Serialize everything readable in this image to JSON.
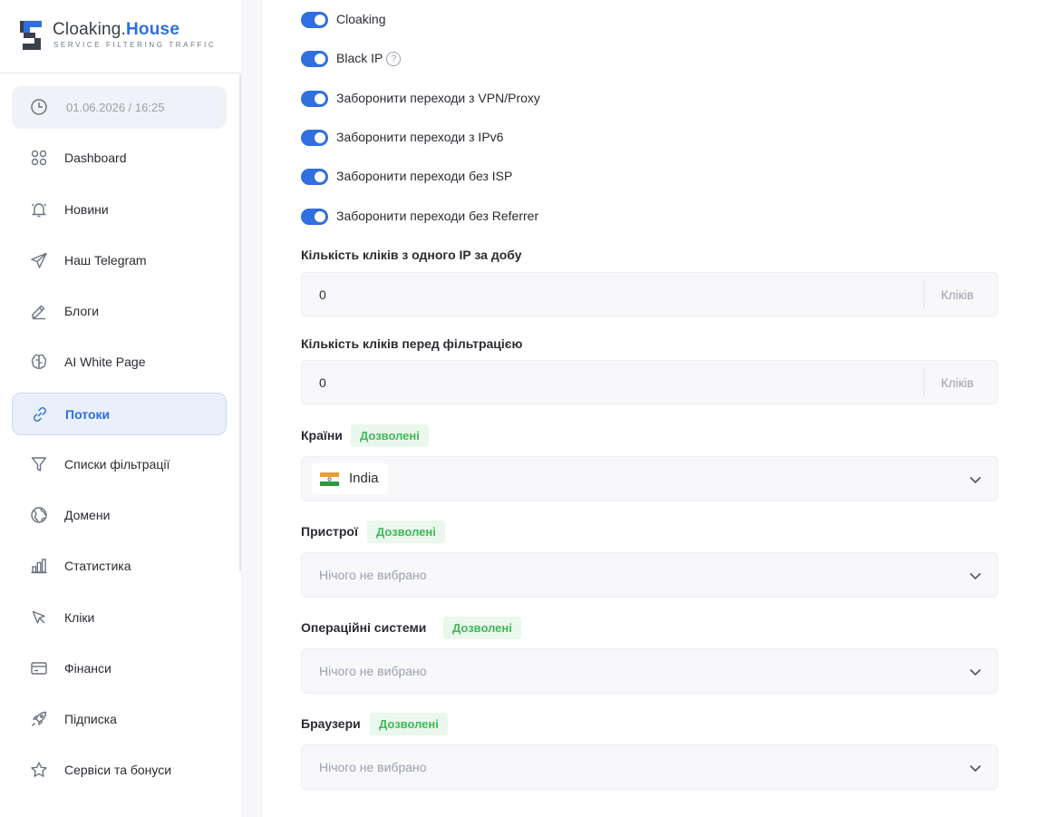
{
  "brand": {
    "name_main": "Cloaking.",
    "name_accent": "House",
    "tagline": "SERVICE FILTERING TRAFFIC"
  },
  "datetime": "01.06.2026 / 16:25",
  "nav": [
    {
      "label": "Dashboard",
      "icon": "dashboard-icon"
    },
    {
      "label": "Новини",
      "icon": "bell-icon"
    },
    {
      "label": "Наш Telegram",
      "icon": "telegram-icon"
    },
    {
      "label": "Блоги",
      "icon": "pencil-icon"
    },
    {
      "label": "AI White Page",
      "icon": "brain-icon"
    },
    {
      "label": "Потоки",
      "icon": "link-icon",
      "active": true
    },
    {
      "label": "Списки фільтрації",
      "icon": "filter-icon"
    },
    {
      "label": "Домени",
      "icon": "globe-icon"
    },
    {
      "label": "Статистика",
      "icon": "bar-chart-icon"
    },
    {
      "label": "Кліки",
      "icon": "cursor-icon"
    },
    {
      "label": "Фінанси",
      "icon": "card-icon"
    },
    {
      "label": "Підписка",
      "icon": "rocket-icon"
    },
    {
      "label": "Сервіси та бонуси",
      "icon": "star-icon"
    }
  ],
  "toggles": [
    {
      "label": "Cloaking",
      "on": true
    },
    {
      "label": "Black IP",
      "on": true,
      "help": "?"
    },
    {
      "label": "Заборонити переходи з VPN/Proxy",
      "on": true
    },
    {
      "label": "Заборонити переходи з IPv6",
      "on": true
    },
    {
      "label": "Заборонити переходи без ISP",
      "on": true
    },
    {
      "label": "Заборонити переходи без Referrer",
      "on": true
    }
  ],
  "clicks_per_ip": {
    "label": "Кількість кліків з одного IP за добу",
    "value": "0",
    "unit": "Кліків"
  },
  "clicks_before_filter": {
    "label": "Кількість кліків перед фільтрацією",
    "value": "0",
    "unit": "Кліків"
  },
  "countries": {
    "label": "Країни",
    "badge": "Дозволені",
    "selected": "India"
  },
  "devices": {
    "label": "Пристрої",
    "badge": "Дозволені",
    "placeholder": "Нічого не вибрано"
  },
  "os": {
    "label": "Операційні системи",
    "badge": "Дозволені",
    "placeholder": "Нічого не вибрано"
  },
  "browsers": {
    "label": "Браузери",
    "badge": "Дозволені",
    "placeholder": "Нічого не вибрано"
  },
  "colors": {
    "accent": "#2f6fe0",
    "badge_text": "#3fba5b",
    "badge_bg": "#eaf7ec"
  }
}
